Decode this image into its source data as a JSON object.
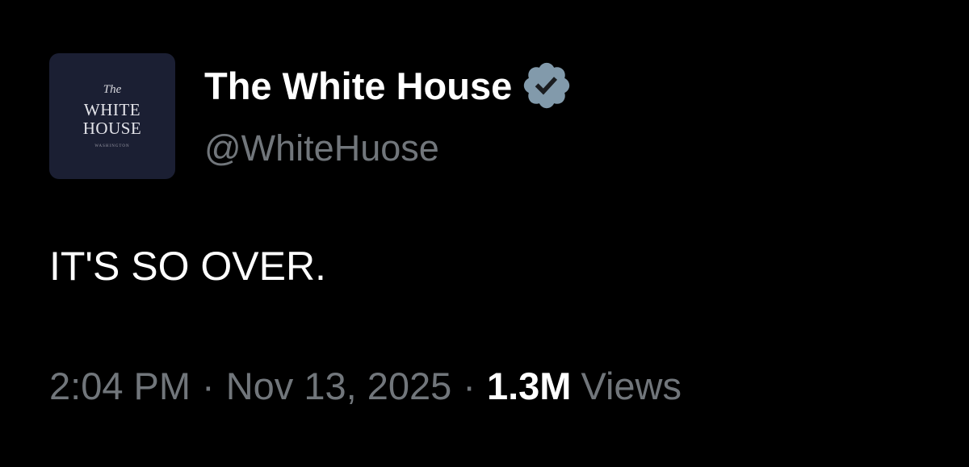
{
  "colors": {
    "background": "#000000",
    "primary_text": "#ffffff",
    "secondary_text": "#71767b",
    "verified_badge": "#829aab",
    "avatar_background": "#1b1f33"
  },
  "author": {
    "avatar_logo": {
      "the": "The",
      "line1": "WHITE",
      "line2": "HOUSE",
      "sub": "WASHINGTON"
    },
    "display_name": "The White House",
    "verified_icon": "verified-badge-icon",
    "handle": "@WhiteHuose"
  },
  "tweet": {
    "text": "IT'S SO OVER."
  },
  "meta": {
    "time": "2:04 PM",
    "separator": "·",
    "date": "Nov 13, 2025",
    "views_count": "1.3M",
    "views_label": "Views"
  }
}
